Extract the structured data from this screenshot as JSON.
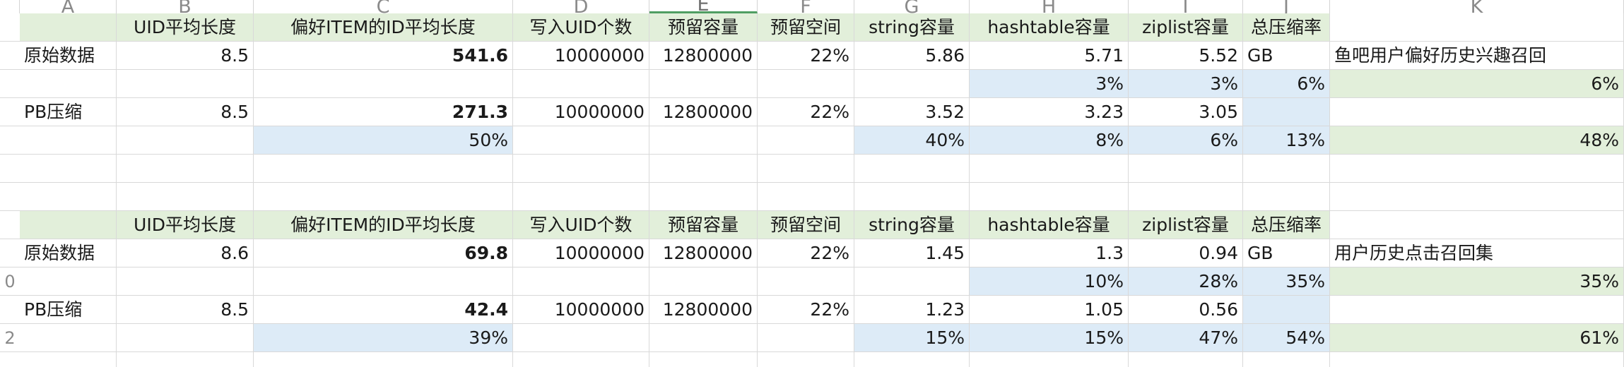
{
  "sheet": {
    "columns": [
      "A",
      "B",
      "C",
      "D",
      "E",
      "F",
      "G",
      "H",
      "I",
      "J",
      "K"
    ],
    "selected_column": "E",
    "row_numbers": [
      "",
      "",
      "",
      "",
      "",
      "",
      "",
      "",
      "",
      "0",
      "",
      "2"
    ],
    "colors": {
      "header_fill": "#e2efda",
      "pct_fill": "#ddebf7",
      "ratio_fill": "#e2efda",
      "grid": "#d9d9d9",
      "selected_col_bar": "#4f9e62"
    }
  },
  "blocks": [
    {
      "header": {
        "b": "UID平均长度",
        "c": "偏好ITEM的ID平均长度",
        "d": "写入UID个数",
        "e": "预留容量",
        "f": "预留空间",
        "g": "string容量",
        "h": "hashtable容量",
        "i": "ziplist容量",
        "j": "总压缩率"
      },
      "raw": {
        "a": "原始数据",
        "b": "8.5",
        "c": "541.6",
        "d": "10000000",
        "e": "12800000",
        "f": "22%",
        "g": "5.86",
        "h": "5.71",
        "i": "5.52",
        "j": "GB",
        "k": "鱼吧用户偏好历史兴趣召回"
      },
      "raw_pct": {
        "h": "3%",
        "i": "3%",
        "j": "6%",
        "k": "6%"
      },
      "pb": {
        "a": "PB压缩",
        "b": "8.5",
        "c": "271.3",
        "d": "10000000",
        "e": "12800000",
        "f": "22%",
        "g": "3.52",
        "h": "3.23",
        "i": "3.05"
      },
      "pb_pct": {
        "c": "50%",
        "g": "40%",
        "h": "8%",
        "i": "6%",
        "j": "13%",
        "k": "48%"
      }
    },
    {
      "header": {
        "b": "UID平均长度",
        "c": "偏好ITEM的ID平均长度",
        "d": "写入UID个数",
        "e": "预留容量",
        "f": "预留空间",
        "g": "string容量",
        "h": "hashtable容量",
        "i": "ziplist容量",
        "j": "总压缩率"
      },
      "raw": {
        "a": "原始数据",
        "b": "8.6",
        "c": "69.8",
        "d": "10000000",
        "e": "12800000",
        "f": "22%",
        "g": "1.45",
        "h": "1.3",
        "i": "0.94",
        "j": "GB",
        "k": "用户历史点击召回集"
      },
      "raw_pct": {
        "h": "10%",
        "i": "28%",
        "j": "35%",
        "k": "35%"
      },
      "pb": {
        "a": "PB压缩",
        "b": "8.5",
        "c": "42.4",
        "d": "10000000",
        "e": "12800000",
        "f": "22%",
        "g": "1.23",
        "h": "1.05",
        "i": "0.56"
      },
      "pb_pct": {
        "c": "39%",
        "g": "15%",
        "h": "15%",
        "i": "47%",
        "j": "54%",
        "k": "61%"
      }
    }
  ]
}
